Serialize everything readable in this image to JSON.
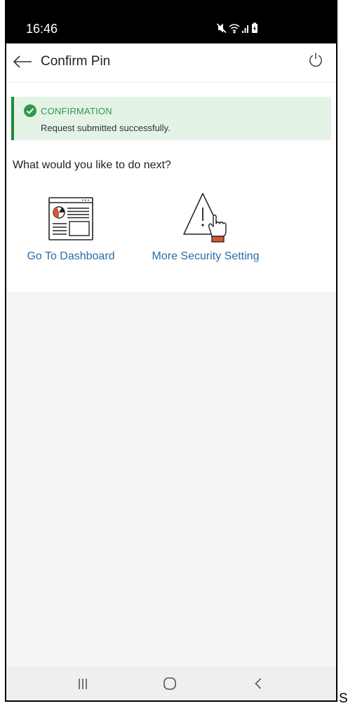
{
  "status_bar": {
    "time": "16:46",
    "icons": [
      "mute-icon",
      "wifi-icon",
      "signal-icon",
      "battery-icon"
    ]
  },
  "app_bar": {
    "title": "Confirm Pin",
    "back_icon": "arrow-left-icon",
    "power_icon": "power-icon"
  },
  "banner": {
    "type": "success",
    "icon": "check-circle-icon",
    "heading": "CONFIRMATION",
    "message": "Request submitted successfully."
  },
  "prompt": "What would you like to do next?",
  "options": [
    {
      "label": "Go To Dashboard",
      "icon": "dashboard-icon"
    },
    {
      "label": "More Security Setting",
      "icon": "security-warning-icon"
    }
  ],
  "nav_bar": {
    "icons": [
      "recent-apps-icon",
      "home-icon",
      "back-icon"
    ]
  },
  "trailing_text": "S",
  "colors": {
    "link": "#2a6ea6",
    "success_green": "#2e9a48",
    "success_bar": "#1e8c3c",
    "banner_bg": "#e4f3e6",
    "accent_red": "#d9533b",
    "status_bar_bg": "#000000"
  }
}
